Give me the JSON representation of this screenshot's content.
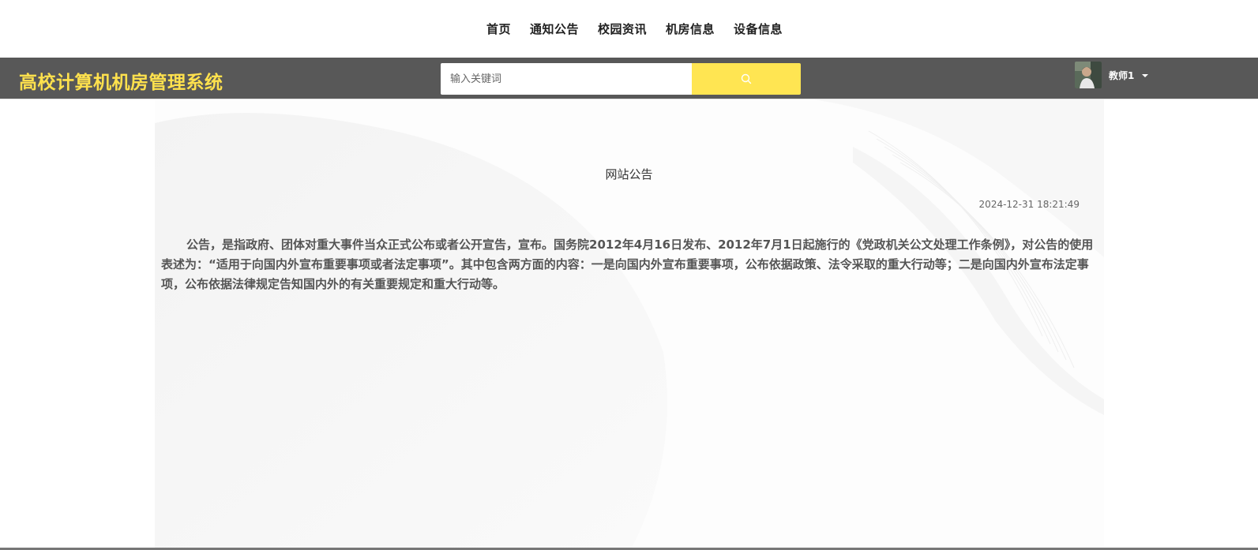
{
  "topnav": {
    "items": [
      {
        "label": "首页"
      },
      {
        "label": "通知公告"
      },
      {
        "label": "校园资讯"
      },
      {
        "label": "机房信息"
      },
      {
        "label": "设备信息"
      }
    ]
  },
  "header": {
    "site_title": "高校计算机机房管理系统",
    "search": {
      "placeholder": "输入关键词",
      "button_icon": "search-icon"
    },
    "user": {
      "name": "教师1",
      "menu_icon": "caret-down-icon"
    }
  },
  "article": {
    "title": "网站公告",
    "time": "2024-12-31 18:21:49",
    "body": "公告，是指政府、团体对重大事件当众正式公布或者公开宣告，宣布。国务院2012年4月16日发布、2012年7月1日起施行的《党政机关公文处理工作条例》，对公告的使用表述为：“适用于向国内外宣布重要事项或者法定事项”。其中包含两方面的内容：一是向国内外宣布重要事项，公布依据政策、法令采取的重大行动等；二是向国内外宣布法定事项，公布依据法律规定告知国内外的有关重要规定和重大行动等。"
  },
  "colors": {
    "header_bg": "#585858",
    "accent_yellow": "#ffe552",
    "title_yellow": "#ffe14d"
  }
}
